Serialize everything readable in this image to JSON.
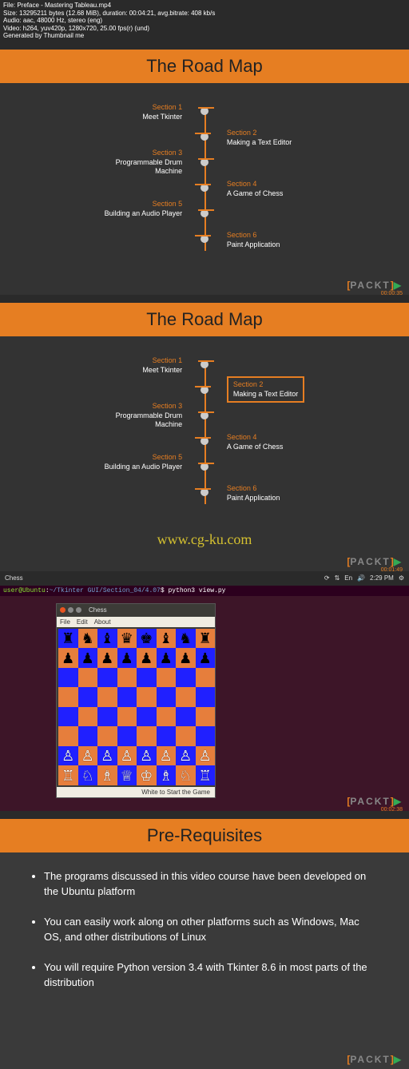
{
  "meta": {
    "line1": "File: Preface - Mastering Tableau.mp4",
    "line2": "Size: 13295211 bytes (12.68 MiB), duration: 00:04:21, avg.bitrate: 408 kb/s",
    "line3": "Audio: aac, 48000 Hz, stereo (eng)",
    "line4": "Video: h264, yuv420p, 1280x720, 25.00 fps(r) (und)",
    "line5": "Generated by Thumbnail me"
  },
  "roadmap": {
    "title": "The Road Map",
    "sections": [
      {
        "num": "Section 1",
        "name": "Meet Tkinter"
      },
      {
        "num": "Section 2",
        "name": "Making a Text Editor"
      },
      {
        "num": "Section 3",
        "name": "Programmable Drum Machine"
      },
      {
        "num": "Section 4",
        "name": "A Game of Chess"
      },
      {
        "num": "Section 5",
        "name": "Building an Audio Player"
      },
      {
        "num": "Section 6",
        "name": "Paint Application"
      }
    ],
    "timestamp1": "00:00:35",
    "timestamp2": "00:01:49"
  },
  "watermark": "www.cg-ku.com",
  "ubuntu": {
    "app_title": "Chess",
    "time": "2:29 PM",
    "prompt_user": "user@Ubuntu",
    "prompt_path": "~/Tkinter GUI/Section_04/4.07",
    "prompt_cmd": "$ python3 view.py",
    "menu_file": "File",
    "menu_edit": "Edit",
    "menu_about": "About",
    "status": "White to Start the Game",
    "timestamp": "00:02:38"
  },
  "prereq": {
    "title": "Pre-Requisites",
    "items": [
      "The programs discussed in this video course have been developed on the Ubuntu platform",
      "You can easily work along on other platforms such as Windows, Mac OS, and other distributions of Linux",
      "You will require Python version 3.4 with Tkinter 8.6 in most parts of the distribution"
    ]
  },
  "packt": {
    "text": "PACKT"
  },
  "chess_pieces": {
    "black": [
      "♜",
      "♞",
      "♝",
      "♛",
      "♚",
      "♝",
      "♞",
      "♜"
    ],
    "black_pawn": "♟",
    "white_pawn": "♙",
    "white": [
      "♖",
      "♘",
      "♗",
      "♕",
      "♔",
      "♗",
      "♘",
      "♖"
    ]
  }
}
